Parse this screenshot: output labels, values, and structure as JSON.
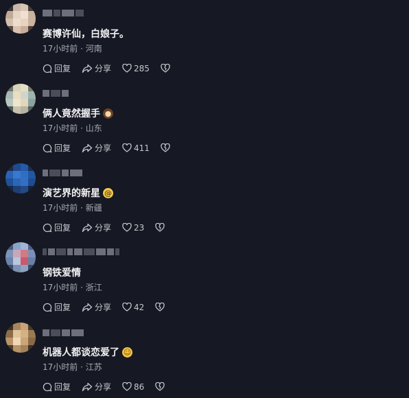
{
  "colors": {
    "background": "#161823",
    "text": "#f1f1f2",
    "meta": "#a9aab2"
  },
  "comments": [
    {
      "text": "赛博许仙，白娘子。",
      "emoji": "",
      "time": "17小时前",
      "location": "河南",
      "reply_label": "回复",
      "share_label": "分享",
      "likes": "285"
    },
    {
      "text": "俩人竟然握手",
      "emoji": "poop-emoji",
      "time": "17小时前",
      "location": "山东",
      "reply_label": "回复",
      "share_label": "分享",
      "likes": "411"
    },
    {
      "text": "演艺界的新星",
      "emoji": "dizzy-face-emoji",
      "time": "17小时前",
      "location": "新疆",
      "reply_label": "回复",
      "share_label": "分享",
      "likes": "23"
    },
    {
      "text": "钢铁爱情",
      "emoji": "",
      "time": "17小时前",
      "location": "浙江",
      "reply_label": "回复",
      "share_label": "分享",
      "likes": "42"
    },
    {
      "text": "机器人都谈恋爱了",
      "emoji": "rolling-laughing-emoji",
      "time": "17小时前",
      "location": "江苏",
      "reply_label": "回复",
      "share_label": "分享",
      "likes": "86"
    }
  ]
}
